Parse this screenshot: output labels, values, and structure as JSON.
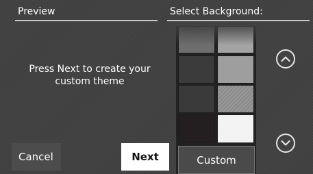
{
  "preview": {
    "header": "Preview",
    "message_line1": "Press Next to create your",
    "message_line2": "custom theme"
  },
  "background": {
    "header": "Select Background:",
    "swatches": [
      {
        "color": "#6e6e6e"
      },
      {
        "color": "#a4a4a4"
      },
      {
        "color": "#3b3b3b"
      },
      {
        "color": "#9e9e9e"
      },
      {
        "color": "#3a3a3a"
      },
      {
        "color": "#8c8c8c"
      },
      {
        "color": "#231f20"
      },
      {
        "color": "#f2f2f2"
      }
    ]
  },
  "scroll": {
    "up_icon": "chevron-up-icon",
    "down_icon": "chevron-down-icon"
  },
  "buttons": {
    "cancel": "Cancel",
    "next": "Next",
    "custom": "Custom"
  }
}
